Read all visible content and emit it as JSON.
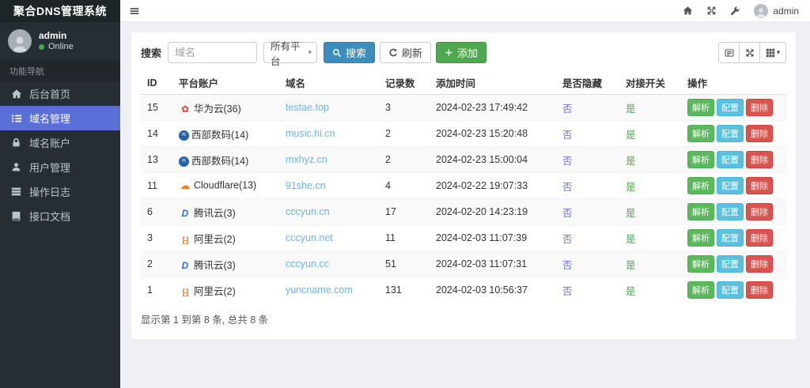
{
  "app": {
    "title": "聚合DNS管理系统"
  },
  "colors": {
    "sidebar_bg": "#272e33",
    "sidebar_active": "#5b70d6",
    "primary": "#3c8dbc",
    "success": "#5cb85c",
    "info": "#5bc0de",
    "danger": "#d9534f",
    "link": "#6fb3e0",
    "toggle_no": "#6b77e0",
    "toggle_yes": "#55a555",
    "online_dot": "#3fae49"
  },
  "sidebar": {
    "user": {
      "name": "admin",
      "status": "Online"
    },
    "section_label": "功能导航",
    "items": [
      {
        "label": "后台首页",
        "icon": "home-icon",
        "active": false
      },
      {
        "label": "域名管理",
        "icon": "list-icon",
        "active": true
      },
      {
        "label": "域名账户",
        "icon": "lock-icon",
        "active": false
      },
      {
        "label": "用户管理",
        "icon": "user-icon",
        "active": false
      },
      {
        "label": "操作日志",
        "icon": "log-icon",
        "active": false
      },
      {
        "label": "接口文档",
        "icon": "book-icon",
        "active": false
      }
    ]
  },
  "navbar": {
    "icons": [
      "menu-icon",
      "home-icon",
      "fullscreen-icon",
      "wrench-icon"
    ],
    "user": "admin"
  },
  "toolbar": {
    "search_label": "搜索",
    "search_placeholder": "域名",
    "platform_select": "所有平台",
    "search_button": "搜索",
    "refresh_button": "刷新",
    "add_button": "添加",
    "right_icons": [
      "card-view-icon",
      "fullscreen-icon",
      "columns-icon"
    ]
  },
  "table": {
    "headers": [
      "ID",
      "平台账户",
      "域名",
      "记录数",
      "添加时间",
      "是否隐藏",
      "对接开关",
      "操作"
    ],
    "actions": [
      "解析",
      "配置",
      "删除"
    ],
    "rows": [
      {
        "id": "15",
        "platform": "华为云(36)",
        "icon": "huawei-cloud-icon",
        "domain": "testae.top",
        "records": "3",
        "added": "2024-02-23 17:49:42",
        "hidden": "否",
        "switch": "是"
      },
      {
        "id": "14",
        "platform": "西部数码(14)",
        "icon": "west-digital-icon",
        "domain": "music.hi.cn",
        "records": "2",
        "added": "2024-02-23 15:20:48",
        "hidden": "否",
        "switch": "是"
      },
      {
        "id": "13",
        "platform": "西部数码(14)",
        "icon": "west-digital-icon",
        "domain": "mxhyz.cn",
        "records": "2",
        "added": "2024-02-23 15:00:04",
        "hidden": "否",
        "switch": "是"
      },
      {
        "id": "11",
        "platform": "Cloudflare(13)",
        "icon": "cloudflare-icon",
        "domain": "91she.cn",
        "records": "4",
        "added": "2024-02-22 19:07:33",
        "hidden": "否",
        "switch": "是"
      },
      {
        "id": "6",
        "platform": "腾讯云(3)",
        "icon": "tencent-cloud-icon",
        "domain": "cccyun.cn",
        "records": "17",
        "added": "2024-02-20 14:23:19",
        "hidden": "否",
        "switch": "是"
      },
      {
        "id": "3",
        "platform": "阿里云(2)",
        "icon": "aliyun-icon",
        "domain": "cccyun.net",
        "records": "11",
        "added": "2024-02-03 11:07:39",
        "hidden": "否",
        "switch": "是"
      },
      {
        "id": "2",
        "platform": "腾讯云(3)",
        "icon": "tencent-cloud-icon",
        "domain": "cccyun.cc",
        "records": "51",
        "added": "2024-02-03 11:07:31",
        "hidden": "否",
        "switch": "是"
      },
      {
        "id": "1",
        "platform": "阿里云(2)",
        "icon": "aliyun-icon",
        "domain": "yuncname.com",
        "records": "131",
        "added": "2024-02-03 10:56:37",
        "hidden": "否",
        "switch": "是"
      }
    ]
  },
  "footer": {
    "summary": "显示第 1 到第 8 条, 总共 8 条"
  }
}
